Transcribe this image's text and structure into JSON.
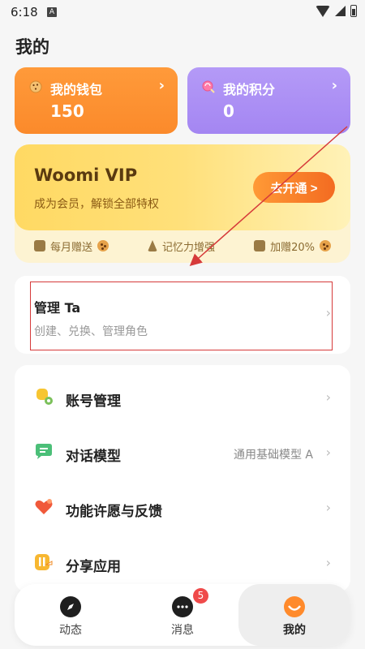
{
  "status_bar": {
    "time": "6:18",
    "notification_glyph": "A"
  },
  "page": {
    "title": "我的"
  },
  "wallet": {
    "label": "我的钱包",
    "value": "150",
    "icon": "cookie-icon"
  },
  "points": {
    "label": "我的积分",
    "value": "0",
    "icon": "lollipop-icon"
  },
  "vip": {
    "title": "Woomi VIP",
    "subtitle": "成为会员，解锁全部特权",
    "button_label": "去开通 >",
    "perks": [
      {
        "label": "每月赠送",
        "icon": "gift-card-icon"
      },
      {
        "label": "记忆力增强",
        "icon": "bolt-icon"
      },
      {
        "label": "加赠20%",
        "icon": "gift-box-icon"
      }
    ]
  },
  "manage": {
    "title": "管理 Ta",
    "subtitle": "创建、兑换、管理角色"
  },
  "menu": [
    {
      "label": "账号管理",
      "value": "",
      "icon": "account-icon"
    },
    {
      "label": "对话模型",
      "value": "通用基础模型 A",
      "icon": "chat-model-icon"
    },
    {
      "label": "功能许愿与反馈",
      "value": "",
      "icon": "heart-icon"
    },
    {
      "label": "分享应用",
      "value": "",
      "icon": "share-icon"
    }
  ],
  "bottom_nav": {
    "items": [
      {
        "label": "动态",
        "icon": "compass-icon"
      },
      {
        "label": "消息",
        "icon": "message-icon",
        "badge": "5"
      },
      {
        "label": "我的",
        "icon": "profile-icon",
        "active": true
      }
    ]
  },
  "colors": {
    "wallet_bg": "#fb8a2b",
    "points_bg": "#a486f2",
    "vip_button": "#f36b21",
    "highlight": "#d63a3a",
    "badge": "#ef4a4a"
  }
}
